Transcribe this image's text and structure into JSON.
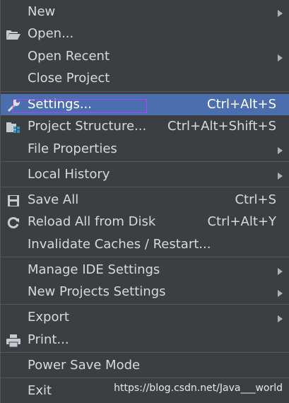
{
  "menu": {
    "new": {
      "label": "New"
    },
    "open": {
      "label": "Open..."
    },
    "open_recent": {
      "label": "Open Recent"
    },
    "close_project": {
      "label": "Close Project"
    },
    "settings": {
      "label": "Settings...",
      "shortcut": "Ctrl+Alt+S"
    },
    "project_structure": {
      "label": "Project Structure...",
      "shortcut": "Ctrl+Alt+Shift+S"
    },
    "file_properties": {
      "label": "File Properties"
    },
    "local_history": {
      "label": "Local History"
    },
    "save_all": {
      "label": "Save All",
      "shortcut": "Ctrl+S"
    },
    "reload_all": {
      "label": "Reload All from Disk",
      "shortcut": "Ctrl+Alt+Y"
    },
    "invalidate_caches": {
      "label": "Invalidate Caches / Restart..."
    },
    "manage_ide_settings": {
      "label": "Manage IDE Settings"
    },
    "new_projects_settings": {
      "label": "New Projects Settings"
    },
    "export": {
      "label": "Export"
    },
    "print": {
      "label": "Print..."
    },
    "power_save_mode": {
      "label": "Power Save Mode"
    },
    "exit": {
      "label": "Exit"
    }
  },
  "watermark": "https://blog.csdn.net/Java___world",
  "colors": {
    "background": "#3c3f41",
    "selection": "#4b6eaf",
    "text": "#d9d9d9",
    "focus_outline": "#b440ff"
  },
  "icons": {
    "open": "folder-open-icon",
    "settings": "wrench-icon",
    "project_structure": "project-structure-icon",
    "save_all": "save-icon",
    "reload_all": "reload-icon",
    "print": "printer-icon"
  }
}
